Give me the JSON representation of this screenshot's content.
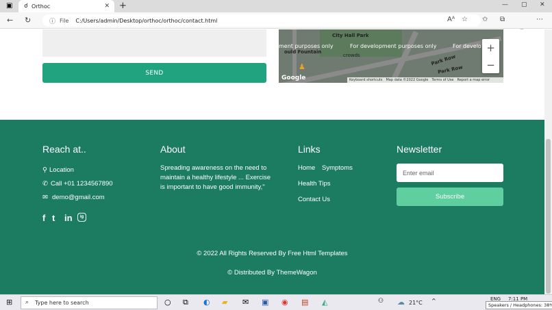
{
  "browser": {
    "tab_title": "Orthoc",
    "tab_close": "✕",
    "new_tab": "+",
    "file_label": "File",
    "url": "C:/Users/admin/Desktop/orthoc/orthoc/contact.html",
    "window_controls": [
      "—",
      "▢",
      "✕"
    ]
  },
  "form": {
    "send_label": "SEND"
  },
  "map": {
    "labels": {
      "city_hall_park": "City Hall Park",
      "fountain": "ould Fountain",
      "park_row": "Park Row",
      "park_row_2": "Park Row",
      "crowds": "crowds"
    },
    "overlay": [
      "ment purposes only",
      "For development purposes only",
      "For develo"
    ],
    "zoom_in": "+",
    "zoom_out": "−",
    "google": "Google",
    "footer_items": [
      "Keyboard shortcuts",
      "Map data ©2022 Google",
      "Terms of Use",
      "Report a map error"
    ]
  },
  "footer": {
    "reach": {
      "title": "Reach at..",
      "location": "Location",
      "phone": "Call +01 1234567890",
      "email": "demo@gmail.com",
      "social": [
        "f",
        "t",
        "in",
        "ig"
      ]
    },
    "about": {
      "title": "About",
      "text": "Spreading awareness on the need to maintain a healthy lifestyle ... Exercise is important to have good immunity,\""
    },
    "links": {
      "title": "Links",
      "items": [
        "Home",
        "Symptoms",
        "Health Tips",
        "Contact Us"
      ]
    },
    "newsletter": {
      "title": "Newsletter",
      "placeholder": "Enter email",
      "button": "Subscribe"
    },
    "copyright": "© 2022 All Rights Reserved By Free Html Templates",
    "distributed": "© Distributed By ThemeWagon"
  },
  "taskbar": {
    "search_placeholder": "Type here to search",
    "weather": "21°C",
    "language": "ENG",
    "time": "7:11 PM",
    "tooltip": "Speakers / Headphones: 38%"
  },
  "colors": {
    "footer_bg": "#1b7c61",
    "send_button": "#21a37f",
    "subscribe_button": "#5fcf9f"
  }
}
